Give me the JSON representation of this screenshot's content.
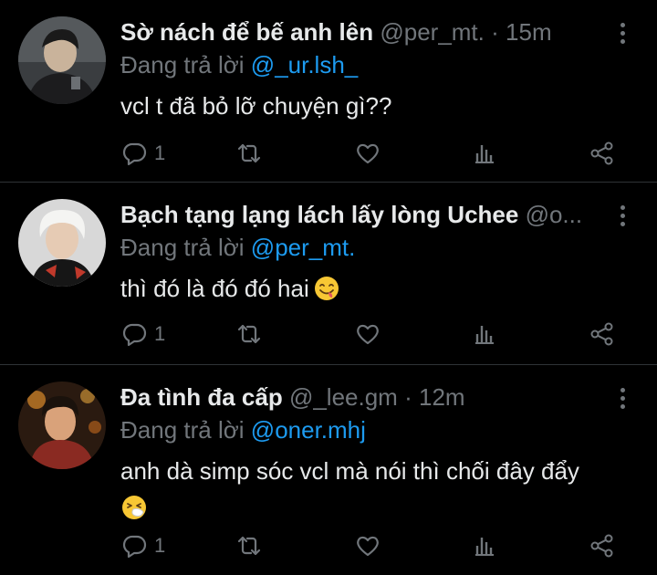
{
  "colors": {
    "background": "#000000",
    "text": "#e7e9ea",
    "muted": "#71767b",
    "accent": "#1d9bf0",
    "divider": "#2f3336"
  },
  "replying_label": "Đang trả lời",
  "tweets": [
    {
      "name": "Sờ nách để bế anh lên",
      "handle": "@per_mt.",
      "separator": "·",
      "time": "15m",
      "replying_to": "@_ur.lsh_",
      "text": "vcl t đã bỏ lỡ chuyện gì??",
      "emoji": "",
      "reply_count": "1",
      "icons": [
        "reply-icon",
        "retweet-icon",
        "like-icon",
        "views-icon",
        "share-icon"
      ]
    },
    {
      "name": "Bạch tạng lạng lách lấy lòng Uchee",
      "handle": "@o...",
      "separator": "",
      "time": "",
      "replying_to": "@per_mt.",
      "text": "thì đó là đó đó hai",
      "emoji": "face-savoring-food-emoji",
      "reply_count": "1",
      "icons": [
        "reply-icon",
        "retweet-icon",
        "like-icon",
        "views-icon",
        "share-icon"
      ]
    },
    {
      "name": "Đa tình đa cấp",
      "handle": "@_lee.gm",
      "separator": "·",
      "time": "12m",
      "replying_to": "@oner.mhj",
      "text": "anh dà simp sóc vcl mà nói thì chối đây đẩy",
      "emoji": "sneezing-face-emoji",
      "reply_count": "1",
      "icons": [
        "reply-icon",
        "retweet-icon",
        "like-icon",
        "views-icon",
        "share-icon"
      ]
    }
  ]
}
